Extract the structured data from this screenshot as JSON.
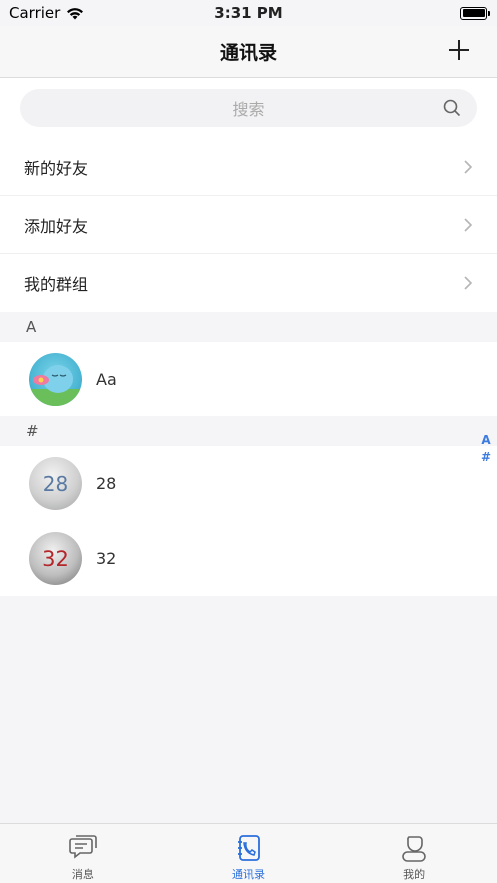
{
  "status_bar": {
    "carrier": "Carrier",
    "time": "3:31 PM"
  },
  "header": {
    "title": "通讯录"
  },
  "search": {
    "placeholder": "搜索"
  },
  "menu": [
    {
      "label": "新的好友"
    },
    {
      "label": "添加好友"
    },
    {
      "label": "我的群组"
    }
  ],
  "sections": [
    {
      "header": "A",
      "contacts": [
        {
          "name": "Aa"
        }
      ]
    },
    {
      "header": "#",
      "contacts": [
        {
          "name": "28",
          "avatar_text": "28"
        },
        {
          "name": "32",
          "avatar_text": "32"
        }
      ]
    }
  ],
  "index_bar": [
    "A",
    "#"
  ],
  "tab_bar": {
    "tabs": [
      {
        "label": "消息",
        "icon": "chat-bubble-icon"
      },
      {
        "label": "通讯录",
        "icon": "contacts-book-icon"
      },
      {
        "label": "我的",
        "icon": "person-icon"
      }
    ],
    "active_index": 1,
    "active_color": "#2a6fdb"
  }
}
